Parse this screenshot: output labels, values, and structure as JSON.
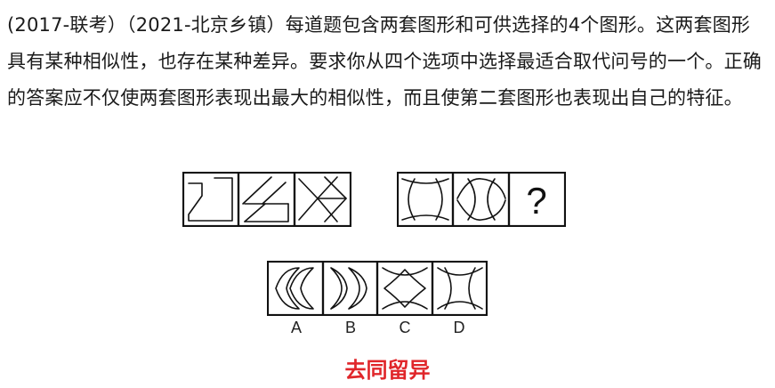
{
  "question": {
    "text": "(2017-联考）（2021-北京乡镇）每道题包含两套图形和可供选择的4个图形。这两套图形具有某种相似性，也存在某种差异。要求你从四个选项中选择最适合取代问号的一个。正确的答案应不仅使两套图形表现出最大的相似性，而且使第二套图形也表现出自己的特征。"
  },
  "puzzle": {
    "question_mark": "?",
    "options": [
      "A",
      "B",
      "C",
      "D"
    ]
  },
  "answer_hint": "去同留异"
}
